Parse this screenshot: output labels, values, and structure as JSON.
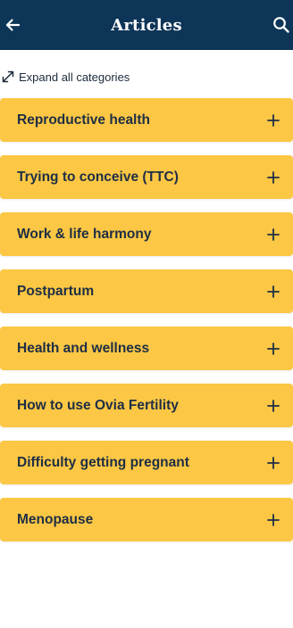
{
  "header": {
    "title": "Articles",
    "back_icon": "arrow-left-icon",
    "search_icon": "search-icon",
    "background_color": "#0d3557"
  },
  "expand": {
    "label": "Expand all categories",
    "icon": "expand-arrows-icon"
  },
  "categories": [
    {
      "label": "Reproductive health"
    },
    {
      "label": "Trying to conceive (TTC)"
    },
    {
      "label": "Work & life harmony"
    },
    {
      "label": "Postpartum"
    },
    {
      "label": "Health and wellness"
    },
    {
      "label": "How to use Ovia Fertility"
    },
    {
      "label": "Difficulty getting pregnant"
    },
    {
      "label": "Menopause"
    }
  ],
  "category_color": "#fbc744"
}
